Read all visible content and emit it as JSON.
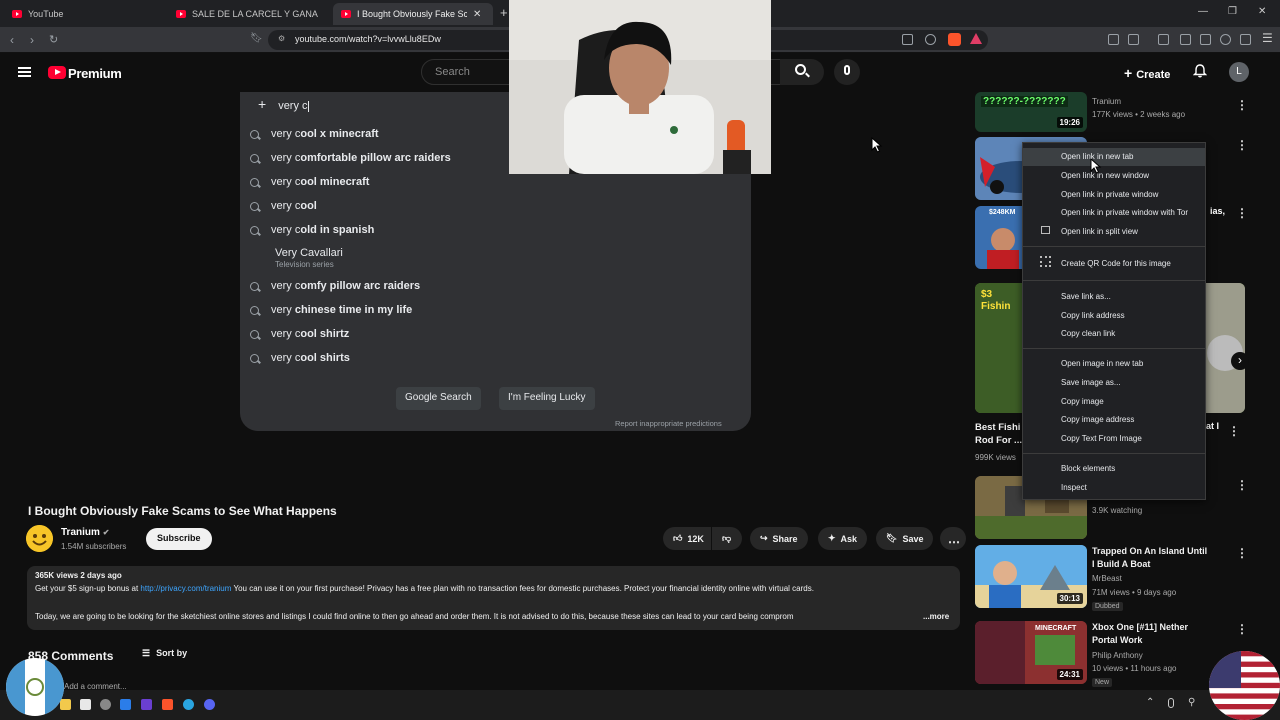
{
  "browser": {
    "tabs": [
      {
        "label": "YouTube",
        "active": false
      },
      {
        "label": "SALE DE LA CARCEL Y GANA MILES D",
        "active": false
      },
      {
        "label": "I Bought Obviously Fake Scam",
        "active": true
      }
    ],
    "new_tab": "+",
    "url": "youtube.com/watch?v=lvvwLlu8EDw"
  },
  "youtube_header": {
    "logo_text": "Premium",
    "search_placeholder": "Search",
    "create_label": "Create",
    "avatar_letter": "L"
  },
  "google_dropdown": {
    "query": "very c",
    "suggestions": [
      {
        "prefix": "very c",
        "rest": "ool x minecraft"
      },
      {
        "prefix": "very c",
        "rest": "omfortable pillow arc raiders"
      },
      {
        "prefix": "very c",
        "rest": "ool minecraft"
      },
      {
        "prefix": "very c",
        "rest": "ool"
      },
      {
        "prefix": "very c",
        "rest": "old in spanish"
      }
    ],
    "entity": {
      "title": "Very Cavallari",
      "subtitle": "Television series"
    },
    "suggestions2": [
      {
        "prefix": "very c",
        "rest": "omfy pillow arc raiders"
      },
      {
        "prefix": "very ",
        "rest": "chinese time in my life"
      },
      {
        "prefix": "very c",
        "rest": "ool shirtz"
      },
      {
        "prefix": "very c",
        "rest": "ool shirts"
      }
    ],
    "google_search": "Google Search",
    "feeling_lucky": "I'm Feeling Lucky",
    "report": "Report inappropriate predictions"
  },
  "sidebar": {
    "videos": [
      {
        "thumb_text": "??????-???????",
        "title": "",
        "channel": "Tranium",
        "meta": "177K views • 2 weeks ago",
        "duration": "19:26",
        "thumb_color": "#1b3d2a"
      },
      {
        "thumb_text": "",
        "title": "",
        "channel": "",
        "meta": "",
        "duration": "",
        "thumb_color": "#2f4f78"
      },
      {
        "thumb_text": "$248KM",
        "title": "",
        "channel": "",
        "meta": "",
        "duration": "",
        "thumb_color": "#3a6fb0"
      },
      {
        "thumb_text": "$3 Fishin",
        "title": "Best Fishi Rod For ...",
        "channel": "",
        "meta": "999K views",
        "duration": "",
        "thumb_color": "#4a6b2a"
      },
      {
        "thumb_text": "",
        "title": "",
        "channel": "",
        "meta": "3.9K watching",
        "duration": "",
        "thumb_color": "#6a5a3a"
      },
      {
        "thumb_text": "",
        "title": "Trapped On An Island Until I Build A Boat",
        "channel": "MrBeast",
        "meta": "71M views • 9 days ago",
        "duration": "30:13",
        "badge": "Dubbed",
        "thumb_color": "#3a86c9"
      },
      {
        "thumb_text": "MINECRAFT",
        "title": "Xbox One [#11] Nether Portal Work",
        "channel": "Philip Anthony",
        "meta": "10 views • 11 hours ago",
        "duration": "24:31",
        "badge": "New",
        "thumb_color": "#7a2a2a"
      }
    ],
    "partial_title_right": "at I",
    "partial_title_right2": "ias,"
  },
  "context_menu": {
    "items": [
      "Open link in new tab",
      "Open link in new window",
      "Open link in private window",
      "Open link in private window with Tor",
      "Open link in split view",
      "Create QR Code for this image",
      "Save link as...",
      "Copy link address",
      "Copy clean link",
      "Open image in new tab",
      "Save image as...",
      "Copy image",
      "Copy image address",
      "Copy Text From Image",
      "Block elements",
      "Inspect"
    ]
  },
  "video": {
    "title": "I Bought Obviously Fake Scams to See What Happens",
    "channel": "Tranium",
    "subscribers": "1.54M subscribers",
    "subscribe": "Subscribe",
    "likes": "12K",
    "share": "Share",
    "ask": "Ask",
    "save": "Save",
    "stats": "365K views  2 days ago",
    "desc_line1_pre": "Get your $5 sign-up bonus at ",
    "desc_link": "http://privacy.com/tranium",
    "desc_line1_post": " You can use it on your first purchase! Privacy has a free plan with no transaction fees for domestic purchases. Protect your financial identity online with virtual cards.",
    "desc_line2": "Today, we are going to be looking for the sketchiest online stores and listings I could find online to then go ahead and order them. It is not advised to do this, because these sites can lead to your card being comprom",
    "more": "...more",
    "comments": "858 Comments",
    "sort_by": "Sort by",
    "add_comment": "Add a comment..."
  },
  "colors": {
    "yt_red": "#ff0033",
    "link_blue": "#3ea6ff",
    "menu_bg": "#202124",
    "dropdown_bg": "#303134"
  }
}
